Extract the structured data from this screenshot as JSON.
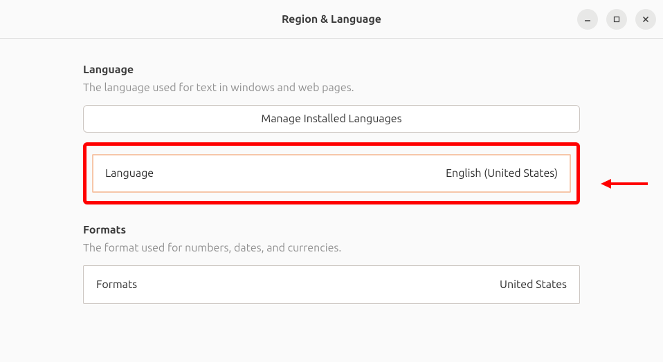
{
  "titlebar": {
    "title": "Region & Language"
  },
  "language_section": {
    "title": "Language",
    "description": "The language used for text in windows and web pages.",
    "manage_button": "Manage Installed Languages",
    "row": {
      "label": "Language",
      "value": "English (United States)"
    }
  },
  "formats_section": {
    "title": "Formats",
    "description": "The format used for numbers, dates, and currencies.",
    "row": {
      "label": "Formats",
      "value": "United States"
    }
  }
}
